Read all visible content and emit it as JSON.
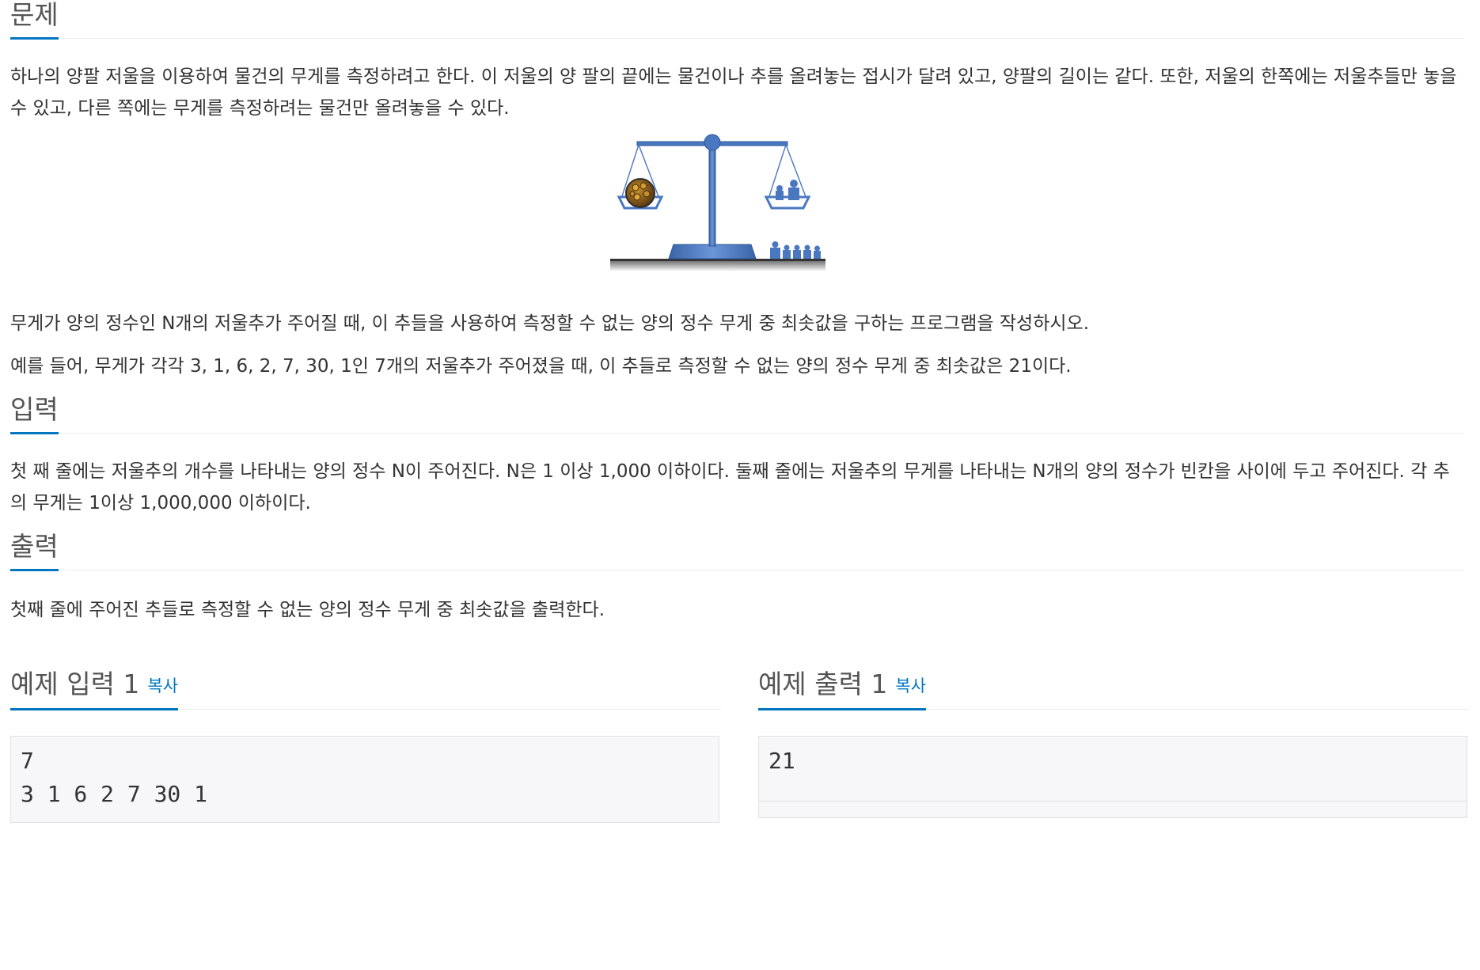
{
  "problem": {
    "title": "문제",
    "paragraphs": [
      "하나의 양팔 저울을 이용하여 물건의 무게를 측정하려고 한다. 이 저울의 양 팔의 끝에는 물건이나 추를 올려놓는 접시가 달려 있고, 양팔의 길이는 같다. 또한, 저울의 한쪽에는 저울추들만 놓을 수 있고, 다른 쪽에는 무게를 측정하려는 물건만 올려놓을 수 있다."
    ],
    "after_figure": [
      "무게가 양의 정수인 N개의 저울추가 주어질 때, 이 추들을 사용하여 측정할 수 없는 양의 정수 무게 중 최솟값을 구하는 프로그램을 작성하시오.",
      "예를 들어, 무게가 각각 3, 1, 6, 2, 7, 30, 1인 7개의 저울추가 주어졌을 때, 이 추들로 측정할 수 없는 양의 정수 무게 중 최솟값은 21이다."
    ]
  },
  "input": {
    "title": "입력",
    "paragraphs": [
      "첫 째 줄에는 저울추의 개수를 나타내는 양의 정수 N이 주어진다. N은 1 이상 1,000 이하이다. 둘째 줄에는 저울추의 무게를 나타내는 N개의 양의 정수가 빈칸을 사이에 두고 주어진다. 각 추의 무게는 1이상 1,000,000 이하이다."
    ]
  },
  "output": {
    "title": "출력",
    "paragraphs": [
      "첫째 줄에 주어진 추들로 측정할 수 없는 양의 정수 무게 중 최솟값을 출력한다."
    ]
  },
  "sample_input": {
    "title": "예제 입력 1",
    "copy_label": "복사",
    "content": "7\n3 1 6 2 7 30 1"
  },
  "sample_output": {
    "title": "예제 출력 1",
    "copy_label": "복사",
    "content": "21"
  },
  "colors": {
    "accent": "#0076c0",
    "scale_blue": "#4a78c0",
    "heading_text": "#555555",
    "body_text": "#333333",
    "code_bg": "#f7f7f9"
  },
  "icons": [
    "balance-scale-illustration"
  ]
}
